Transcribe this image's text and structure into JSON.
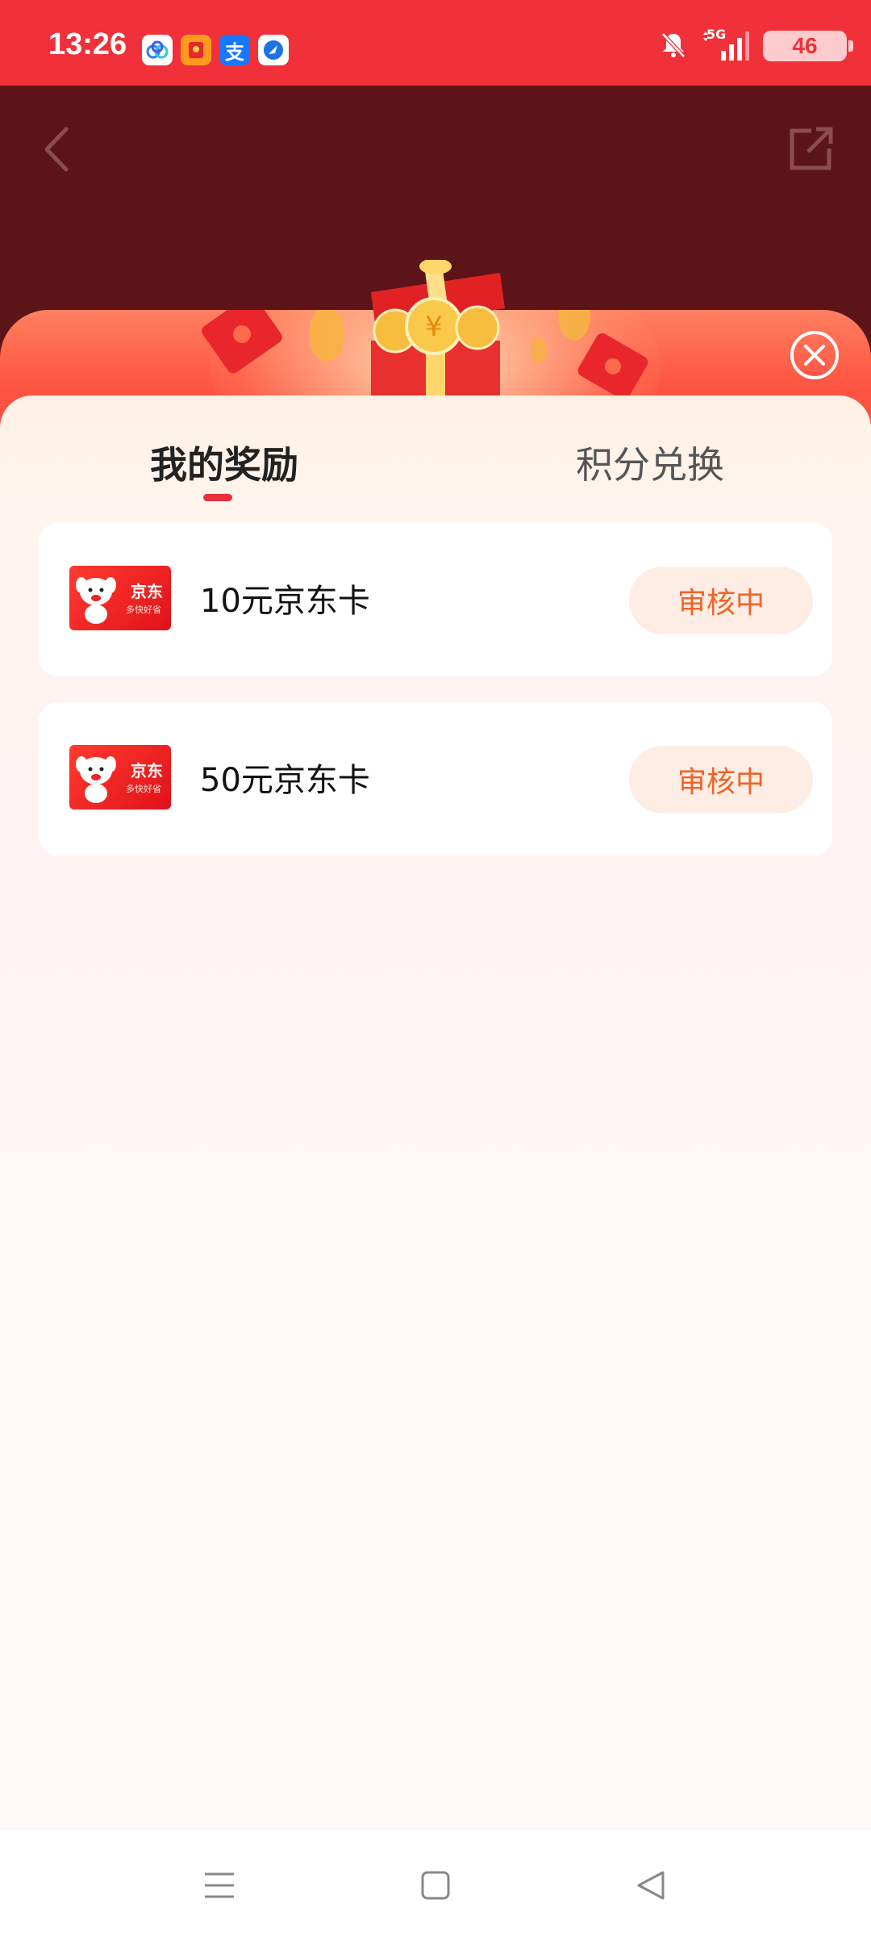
{
  "status_bar": {
    "time": "13:26",
    "network": "5G",
    "battery": "46",
    "app_icons": [
      "baidu-netdisk-icon",
      "red-envelope-app-icon",
      "alipay-icon",
      "browser-app-icon"
    ],
    "alipay_glyph": "支"
  },
  "tabs": [
    {
      "label": "我的奖励",
      "active": true
    },
    {
      "label": "积分兑换",
      "active": false
    }
  ],
  "card_image": {
    "brand": "京东",
    "sub": "多快好省"
  },
  "rewards": [
    {
      "title": "10元京东卡",
      "status": "审核中"
    },
    {
      "title": "50元京东卡",
      "status": "审核中"
    }
  ],
  "colors": {
    "status_bar": "#f0313a",
    "overlay": "#5d1418",
    "accent": "#e8303b",
    "status_button_bg": "#feede4",
    "status_button_text": "#f06428"
  }
}
